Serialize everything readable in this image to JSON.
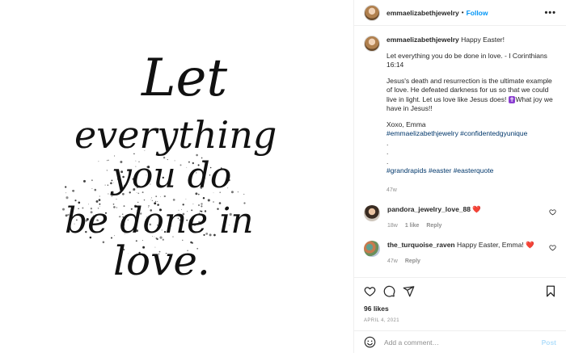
{
  "image": {
    "quote_lines": [
      "Let",
      "everything",
      "you do",
      "be done in",
      "love."
    ]
  },
  "header": {
    "username": "emmaelizabethjewelry",
    "dot": "•",
    "follow_label": "Follow",
    "more_label": "•••"
  },
  "caption": {
    "username": "emmaelizabethjewelry",
    "first_line": "Happy Easter!",
    "verse": "Let everything you do be done in love. - I Corinthians 16:14",
    "paragraph_before_emoji": "Jesus's death and resurrection is the ultimate example of love. He defeated darkness for us so that we could live in light. Let us love like Jesus does!",
    "cross_emoji": "✝",
    "paragraph_after_emoji": "What joy we have in Jesus!!",
    "signoff": "Xoxo, Emma",
    "hashtags_1": "#emmaelizabethjewelry #confidentedgyunique",
    "dots": [
      ".",
      ".",
      "."
    ],
    "hashtags_2": "#grandrapids #easter #easterquote",
    "time": "47w"
  },
  "comments": [
    {
      "username": "pandora_jewelry_love_88",
      "text": "",
      "emoji": "❤️",
      "time": "18w",
      "likes": "1 like",
      "reply": "Reply"
    },
    {
      "username": "the_turquoise_raven",
      "text": "Happy Easter, Emma!",
      "emoji": "❤️",
      "time": "47w",
      "likes": "",
      "reply": "Reply"
    }
  ],
  "actions": {
    "likes_text": "96 likes",
    "date_text": "APRIL 4, 2021"
  },
  "comment_box": {
    "placeholder": "Add a comment…",
    "post_label": "Post"
  },
  "colors": {
    "link": "#00376b",
    "follow": "#0095f6",
    "heart": "#ed4956",
    "post_disabled": "#b2dffc"
  }
}
